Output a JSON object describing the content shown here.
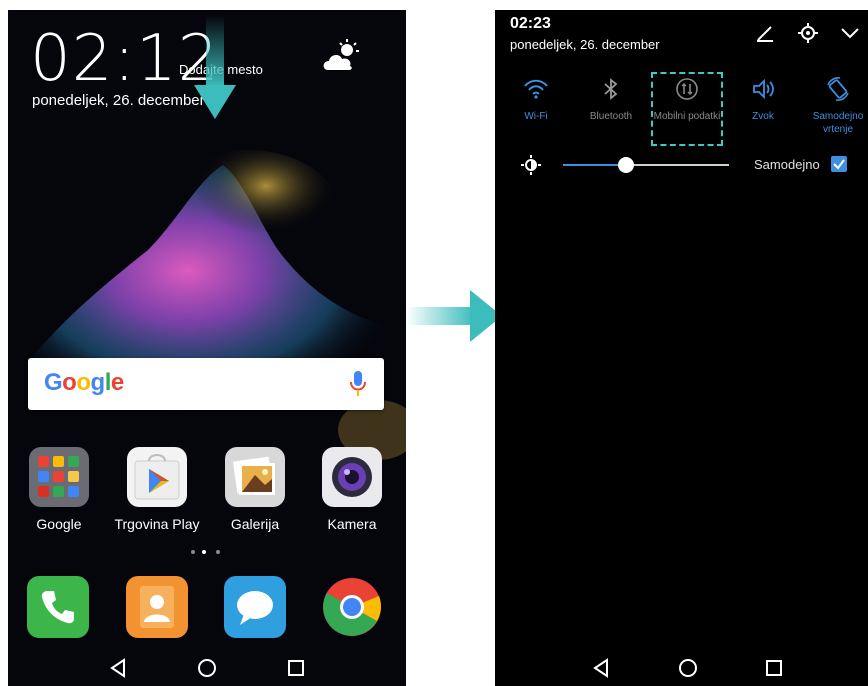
{
  "home": {
    "clock": "02:12",
    "add_location": "Dodajte mesto",
    "date": "ponedeljek, 26. december",
    "search": {
      "logo": [
        "G",
        "o",
        "o",
        "g",
        "l",
        "e"
      ],
      "logo_colors": [
        "#4285f4",
        "#ea4335",
        "#fbbc05",
        "#4285f4",
        "#34a853",
        "#ea4335"
      ]
    },
    "apps": [
      {
        "label": "Google"
      },
      {
        "label": "Trgovina Play"
      },
      {
        "label": "Galerija"
      },
      {
        "label": "Kamera"
      }
    ],
    "dock": [
      {
        "icon": "phone-icon"
      },
      {
        "icon": "contacts-icon"
      },
      {
        "icon": "messages-icon"
      },
      {
        "icon": "chrome-icon"
      }
    ]
  },
  "shade": {
    "time": "02:23",
    "date": "ponedeljek, 26. december",
    "tiles": [
      {
        "label": "Wi-Fi",
        "state": "on"
      },
      {
        "label": "Bluetooth",
        "state": "off"
      },
      {
        "label": "Mobilni podatki",
        "state": "off"
      },
      {
        "label": "Zvok",
        "state": "on"
      },
      {
        "label": "Samodejno vrtenje",
        "state": "on"
      }
    ],
    "brightness_level": 0.38,
    "auto_brightness_label": "Samodejno",
    "auto_brightness_checked": true
  },
  "colors": {
    "accent": "#3f8fe0",
    "highlight": "#40c8c8",
    "arrow": "#3cbcbc"
  }
}
